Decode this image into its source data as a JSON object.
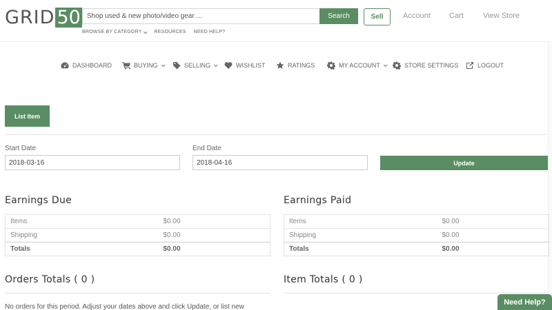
{
  "header": {
    "logo_text": "GRID",
    "logo_number": "50",
    "search_placeholder": "Shop used & new photo/video gear ...",
    "search_button": "Search",
    "subnav": [
      "BROWSE BY CATEGORY",
      "RESOURCES",
      "NEED HELP?"
    ],
    "sell_label": "Sell",
    "links": [
      "Account",
      "Cart",
      "View Store"
    ]
  },
  "nav": {
    "items": [
      {
        "label": "DASHBOARD",
        "icon": "dashboard-icon"
      },
      {
        "label": "BUYING",
        "icon": "cart-icon",
        "dropdown": true
      },
      {
        "label": "SELLING",
        "icon": "tag-icon",
        "dropdown": true
      },
      {
        "label": "WISHLIST",
        "icon": "heart-icon"
      },
      {
        "label": "RATINGS",
        "icon": "star-icon"
      },
      {
        "label": "MY ACCOUNT",
        "icon": "gear-icon",
        "dropdown": true
      },
      {
        "label": "STORE SETTINGS",
        "icon": "gear-icon"
      },
      {
        "label": "LOGOUT",
        "icon": "external-link-icon"
      }
    ]
  },
  "list_item_label": "List Item",
  "filters": {
    "start_label": "Start Date",
    "start_value": "2018-03-16",
    "end_label": "End Date",
    "end_value": "2018-04-16",
    "update_label": "Update"
  },
  "earnings_due": {
    "title": "Earnings Due",
    "rows": [
      {
        "label": "Items",
        "value": "$0.00"
      },
      {
        "label": "Shipping",
        "value": "$0.00"
      },
      {
        "label": "Totals",
        "value": "$0.00"
      }
    ]
  },
  "earnings_paid": {
    "title": "Earnings Paid",
    "rows": [
      {
        "label": "Items",
        "value": "$0.00"
      },
      {
        "label": "Shipping",
        "value": "$0.00"
      },
      {
        "label": "Totals",
        "value": "$0.00"
      }
    ]
  },
  "orders_totals_title": "Orders Totals ( 0 )",
  "item_totals_title": "Item Totals ( 0 )",
  "no_orders_text": "No orders for this period. Adjust your dates above and click Update, or list new",
  "need_help_label": "Need Help?",
  "colors": {
    "accent": "#5a8d63"
  }
}
